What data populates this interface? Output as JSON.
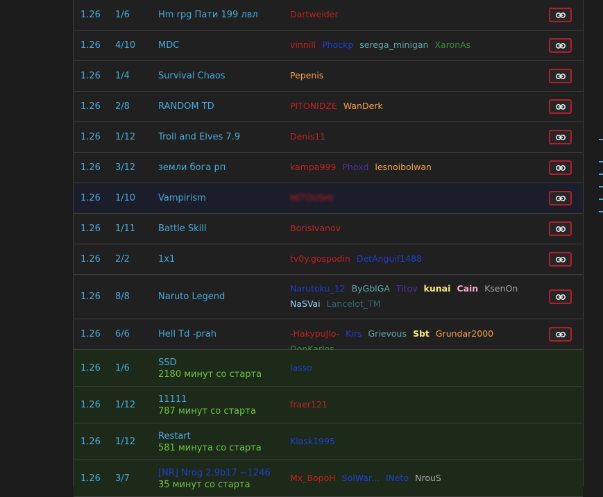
{
  "colors": {
    "default": "#49a9da",
    "started_label": "#6cc644",
    "red": "#c42020",
    "orange": "#f5a04c",
    "blue": "#1d3fcf",
    "green": "#3d8a3d",
    "teal": "#5fa8a8",
    "purple": "#4d2fa0",
    "yellow": "#f7e97c",
    "pink": "#f5a9c8",
    "lightblue": "#8fd0ff",
    "gray": "#a6a6a6",
    "darkteal": "#2e6b6b",
    "join_border": "#b01e2e"
  },
  "join_icon": "link-icon",
  "rows": [
    {
      "version": "1.26",
      "slots": "1/6",
      "name": "Hm rpg Пати 199 лвл",
      "players": [
        {
          "n": "Dartweider",
          "c": "red"
        }
      ],
      "join": true
    },
    {
      "version": "1.26",
      "slots": "4/10",
      "name": "MDC",
      "players": [
        {
          "n": "vinnill",
          "c": "red"
        },
        {
          "n": "Phockp",
          "c": "blue"
        },
        {
          "n": "serega_minigan",
          "c": "teal"
        },
        {
          "n": "XaronAs",
          "c": "green"
        }
      ],
      "join": true
    },
    {
      "version": "1.26",
      "slots": "1/4",
      "name": "Survival Chaos",
      "players": [
        {
          "n": "Pepenis",
          "c": "orange"
        }
      ],
      "join": true
    },
    {
      "version": "1.26",
      "slots": "2/8",
      "name": "RANDOM TD",
      "players": [
        {
          "n": "PITONIDZE",
          "c": "red"
        },
        {
          "n": "WanDerk",
          "c": "orange"
        }
      ],
      "join": true
    },
    {
      "version": "1.26",
      "slots": "1/12",
      "name": "Troll and Elves 7.9",
      "players": [
        {
          "n": "Denis11",
          "c": "red"
        }
      ],
      "join": true
    },
    {
      "version": "1.26",
      "slots": "3/12",
      "name": "земли бога рп",
      "players": [
        {
          "n": "kampa999",
          "c": "red"
        },
        {
          "n": "Phoxd",
          "c": "purple"
        },
        {
          "n": "lesnoibolwan",
          "c": "orange"
        }
      ],
      "join": true
    },
    {
      "version": "1.26",
      "slots": "1/10",
      "name": "Vampirism",
      "players": [
        {
          "n": "MITOUSHI",
          "c": "red",
          "blur": true
        }
      ],
      "join": true,
      "highlight": true
    },
    {
      "version": "1.26",
      "slots": "1/11",
      "name": "Battle Skill",
      "players": [
        {
          "n": "BorisIvanov",
          "c": "red"
        }
      ],
      "join": true
    },
    {
      "version": "1.26",
      "slots": "2/2",
      "name": "1x1",
      "players": [
        {
          "n": "tv0y.gospodin",
          "c": "red"
        },
        {
          "n": "DetAnguif1488",
          "c": "blue"
        }
      ],
      "join": true
    },
    {
      "version": "1.26",
      "slots": "8/8",
      "name": "Naruto Legend",
      "players": [
        {
          "n": "Narutoku_12",
          "c": "blue"
        },
        {
          "n": "ByGblGA",
          "c": "teal"
        },
        {
          "n": "Titov",
          "c": "purple"
        },
        {
          "n": "kunai",
          "c": "yellow",
          "bold": true
        },
        {
          "n": "Cain",
          "c": "pink",
          "bold": true
        },
        {
          "n": "KsenOn",
          "c": "gray"
        },
        {
          "n": "NaSVai",
          "c": "lightblue"
        },
        {
          "n": "Lancelot_TM",
          "c": "darkteal"
        }
      ],
      "join": true
    },
    {
      "version": "1.26",
      "slots": "6/6",
      "name": "Hell Td -prah",
      "players": [
        {
          "n": "-HakypuJlo-",
          "c": "red"
        },
        {
          "n": "Kirs",
          "c": "blue"
        },
        {
          "n": "Grievous",
          "c": "teal"
        },
        {
          "n": "Sbt",
          "c": "yellow",
          "bold": true
        },
        {
          "n": "Grundar2000",
          "c": "orange"
        },
        {
          "n": "DonKarlos",
          "c": "green"
        }
      ],
      "join": true
    },
    {
      "version": "1.26",
      "slots": "1/6",
      "name": "SSD",
      "sub": "2180 минут со старта",
      "players": [
        {
          "n": "lasso",
          "c": "blue"
        }
      ],
      "join": false,
      "started": true
    },
    {
      "version": "1.26",
      "slots": "1/12",
      "name": "11111",
      "sub": "787 минут со старта",
      "players": [
        {
          "n": "fraer121",
          "c": "red"
        }
      ],
      "join": false,
      "started": true
    },
    {
      "version": "1.26",
      "slots": "1/12",
      "name": "Restart",
      "sub": "581 минута со старта",
      "players": [
        {
          "n": "Klask1995",
          "c": "blue"
        }
      ],
      "join": false,
      "started": true
    },
    {
      "version": "1.26",
      "slots": "3/7",
      "name": "[NR] Nrog 2.9b17 ~1246",
      "sub": "35 минут со старта",
      "players": [
        {
          "n": "Mx_BopoH",
          "c": "red"
        },
        {
          "n": "SolWar...",
          "c": "blue"
        },
        {
          "n": "INeto",
          "c": "blue"
        },
        {
          "n": "NrouS",
          "c": "gray"
        }
      ],
      "join": false,
      "started": true,
      "nameColor": "blue"
    }
  ]
}
